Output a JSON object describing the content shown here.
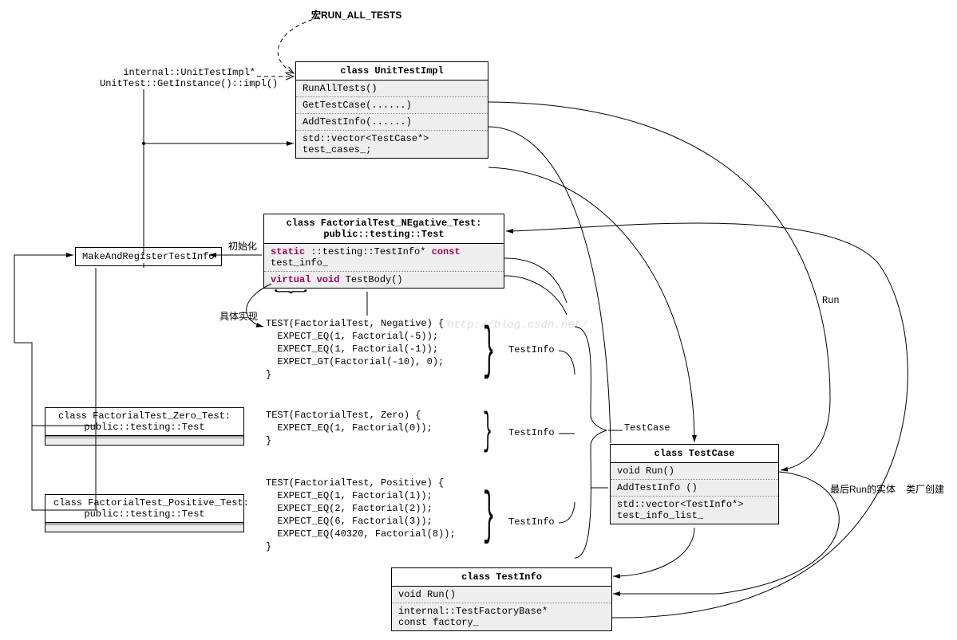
{
  "macro_label": "宏RUN_ALL_TESTS",
  "ptr_lines": "internal::UnitTestImpl*\nUnitTest::GetInstance()::impl()",
  "init_label": "初始化",
  "impl_label": "具体实现",
  "run_label": "Run",
  "run_entity_label": "最后Run的实体",
  "factory_label": "类厂创建",
  "testinfo_label": "TestInfo",
  "testcase_big_label": "TestCase",
  "watermark": "http://blog.csdn.net/",
  "box_makeandreg": "MakeAndRegisterTestInfo",
  "unit_test_impl": {
    "title": "class UnitTestImpl",
    "m1": "RunAllTests()",
    "m2": "GetTestCase(......)",
    "m3": "AddTestInfo(......)",
    "m4": "std::vector<TestCase*>\ntest_cases_;"
  },
  "neg_test": {
    "title": "class FactorialTest_NEgative_Test:\npublic::testing::Test",
    "m1_pre": "static ",
    "m1_mid": "::testing::TestInfo* ",
    "m1_kw": "const",
    "m1_post": " test_info_",
    "m2_pre": "virtual void ",
    "m2_post": "TestBody()"
  },
  "zero_test": {
    "title": "class FactorialTest_Zero_Test:\npublic::testing::Test"
  },
  "pos_test": {
    "title": "class FactorialTest_Positive_Test:\npublic::testing::Test"
  },
  "testcase": {
    "title": "class TestCase",
    "m1": "void Run()",
    "m2": "AddTestInfo ()",
    "m3": "std::vector<TestInfo*>\ntest_info_list_"
  },
  "testinfo": {
    "title": "class TestInfo",
    "m1": "void Run()",
    "m2": "internal::TestFactoryBase*\nconst factory_"
  },
  "code1": "TEST(FactorialTest, Negative) {\n  EXPECT_EQ(1, Factorial(-5));\n  EXPECT_EQ(1, Factorial(-1));\n  EXPECT_GT(Factorial(-10), 0);\n}",
  "code2": "TEST(FactorialTest, Zero) {\n  EXPECT_EQ(1, Factorial(0));\n}",
  "code3": "TEST(FactorialTest, Positive) {\n  EXPECT_EQ(1, Factorial(1));\n  EXPECT_EQ(2, Factorial(2));\n  EXPECT_EQ(6, Factorial(3));\n  EXPECT_EQ(40320, Factorial(8));\n}"
}
